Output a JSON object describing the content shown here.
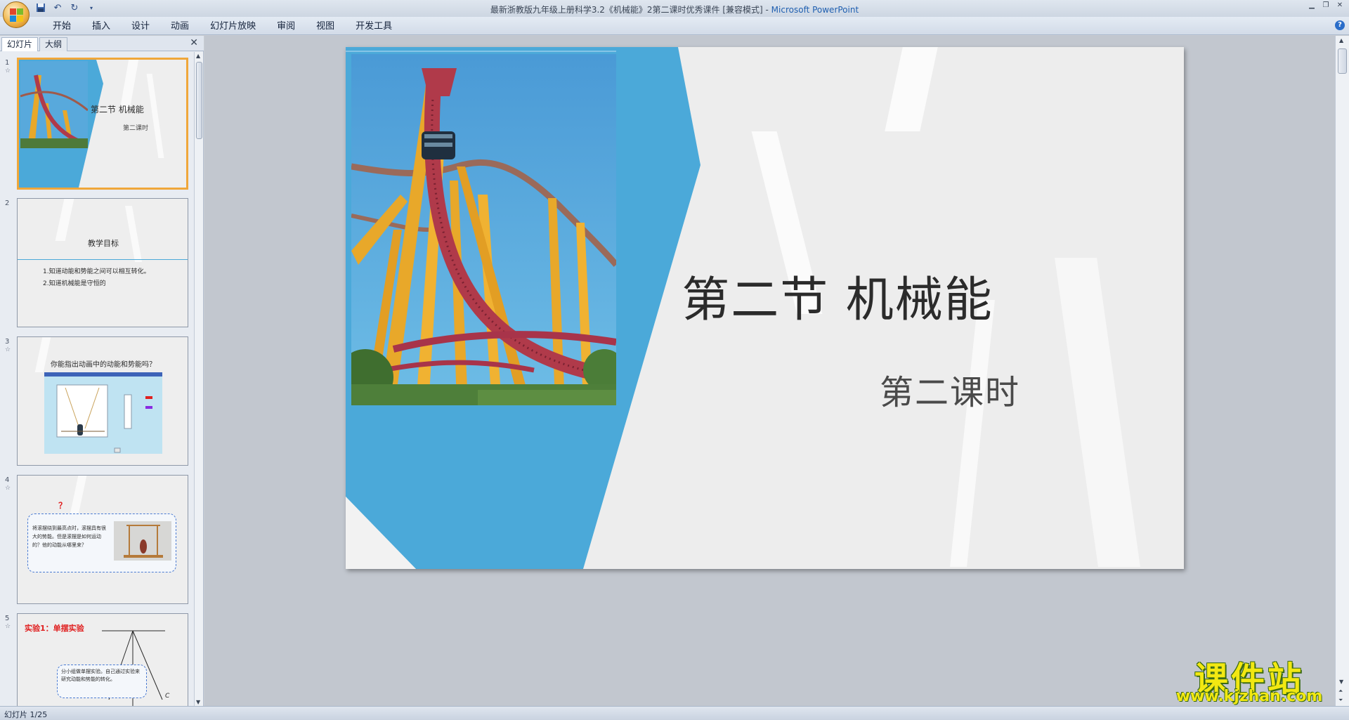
{
  "window": {
    "title_doc": "最新浙教版九年级上册科学3.2《机械能》2第二课时优秀课件 [兼容模式] - ",
    "title_app": "Microsoft PowerPoint"
  },
  "ribbon": {
    "tabs": [
      "开始",
      "插入",
      "设计",
      "动画",
      "幻灯片放映",
      "审阅",
      "视图",
      "开发工具"
    ]
  },
  "pane": {
    "tab_slides": "幻灯片",
    "tab_outline": "大纲"
  },
  "thumbnails": [
    {
      "num": "1",
      "title": "第二节 机械能",
      "subtitle": "第二课时"
    },
    {
      "num": "2",
      "title": "教学目标",
      "lines": [
        "1.知道动能和势能之间可以相互转化。",
        "2.知道机械能是守恒的"
      ]
    },
    {
      "num": "3",
      "title": "你能指出动画中的动能和势能吗？"
    },
    {
      "num": "4",
      "mark": "？",
      "text": "将滚摆绕到最高点时，滚摆具有很大的势能。但是滚摆是如何运动的？他的动能从哪里来？"
    },
    {
      "num": "5",
      "title": "实验1：单摆实验",
      "text": "分小组做单摆实验。自己通过实验来研究动能和势能的转化。",
      "label_c": "C"
    }
  ],
  "slide": {
    "title": "第二节  机械能",
    "subtitle": "第二课时"
  },
  "statusbar": {
    "text": "幻灯片 1/25"
  },
  "watermark": {
    "main": "课件站",
    "url": "www.kjzhan.com"
  },
  "colors": {
    "slide_blue": "#4ba9d9",
    "selection": "#f0a73a",
    "title_accent": "#1f5fb0"
  }
}
